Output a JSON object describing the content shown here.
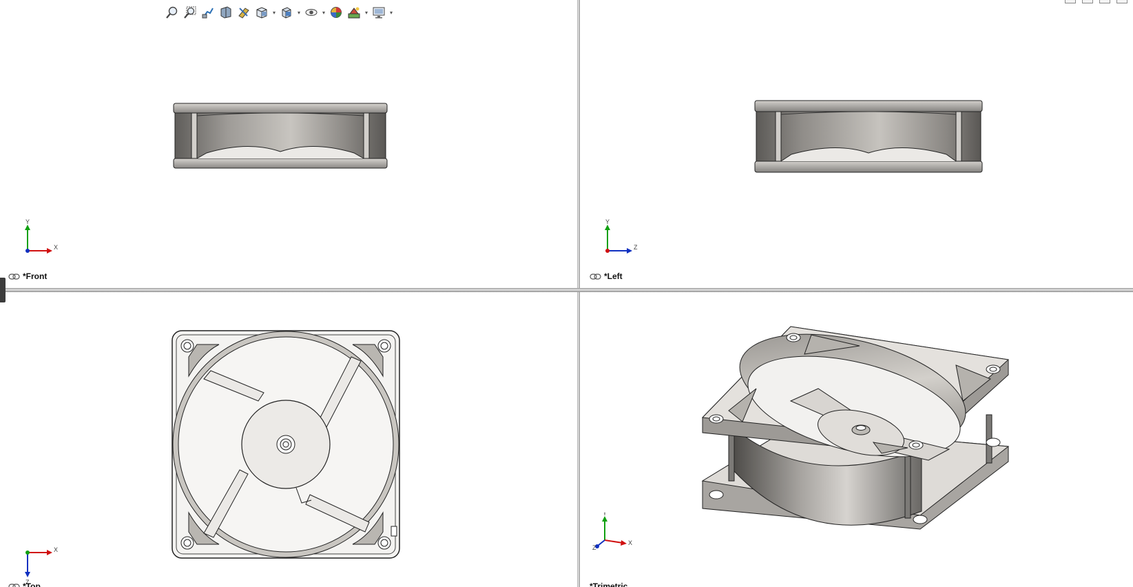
{
  "toolbar": {
    "tools": [
      {
        "name": "zoom-to-fit-icon"
      },
      {
        "name": "zoom-to-area-icon"
      },
      {
        "name": "previous-view-icon"
      },
      {
        "name": "section-view-icon"
      },
      {
        "name": "dynamic-annotation-views-icon"
      },
      {
        "name": "view-orientation-icon",
        "caret": true
      },
      {
        "name": "display-style-icon",
        "caret": true
      },
      {
        "name": "hide-show-items-icon",
        "caret": true
      },
      {
        "name": "edit-appearance-icon"
      },
      {
        "name": "apply-scene-icon",
        "caret": true
      },
      {
        "name": "view-settings-icon",
        "caret": true
      }
    ]
  },
  "viewports": {
    "front": {
      "label": "*Front",
      "axis_h": "X",
      "axis_v": "Y"
    },
    "left": {
      "label": "*Left",
      "axis_h": "Z",
      "axis_v": "Y"
    },
    "top": {
      "label": "*Top",
      "axis_h": "X",
      "axis_v": "Z"
    },
    "trimetric": {
      "label": "*Trimetric",
      "axis_h": "X",
      "axis_v": "Y",
      "axis_d": "Z"
    }
  },
  "colors": {
    "x_axis": "#d01010",
    "y_axis": "#10a010",
    "z_axis": "#1030c0",
    "model_edge": "#2a2a2a",
    "model_face": "#c9c6c1",
    "model_shadow": "#6e6c69",
    "splitter": "#b8b8b8"
  }
}
